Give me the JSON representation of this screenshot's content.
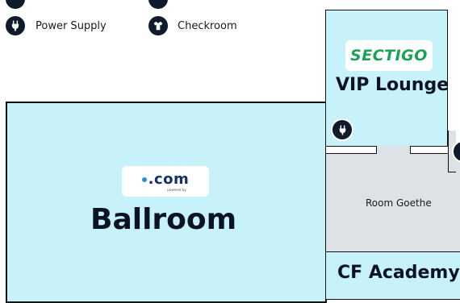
{
  "legend": {
    "items": [
      {
        "label": "Power Supply",
        "icon": "plug-icon"
      },
      {
        "label": "Checkroom",
        "icon": "tshirt-icon"
      }
    ]
  },
  "rooms": {
    "ballroom": {
      "name": "Ballroom",
      "sponsor_logo_text": ".com",
      "sponsor_logo_subtext": "powered by"
    },
    "vip_lounge": {
      "name": "VIP Lounge",
      "sponsor_logo_text": "SECTIGO"
    },
    "goethe": {
      "name": "Room Goethe"
    },
    "cf_academy": {
      "name": "CF Academy"
    }
  },
  "colors": {
    "room_fill": "#c7f2fa",
    "room_alt_fill": "#dde2e6",
    "icon_fill": "#0f1a2a",
    "sectigo_green": "#1aa15a",
    "com_blue": "#2b8fd6"
  }
}
